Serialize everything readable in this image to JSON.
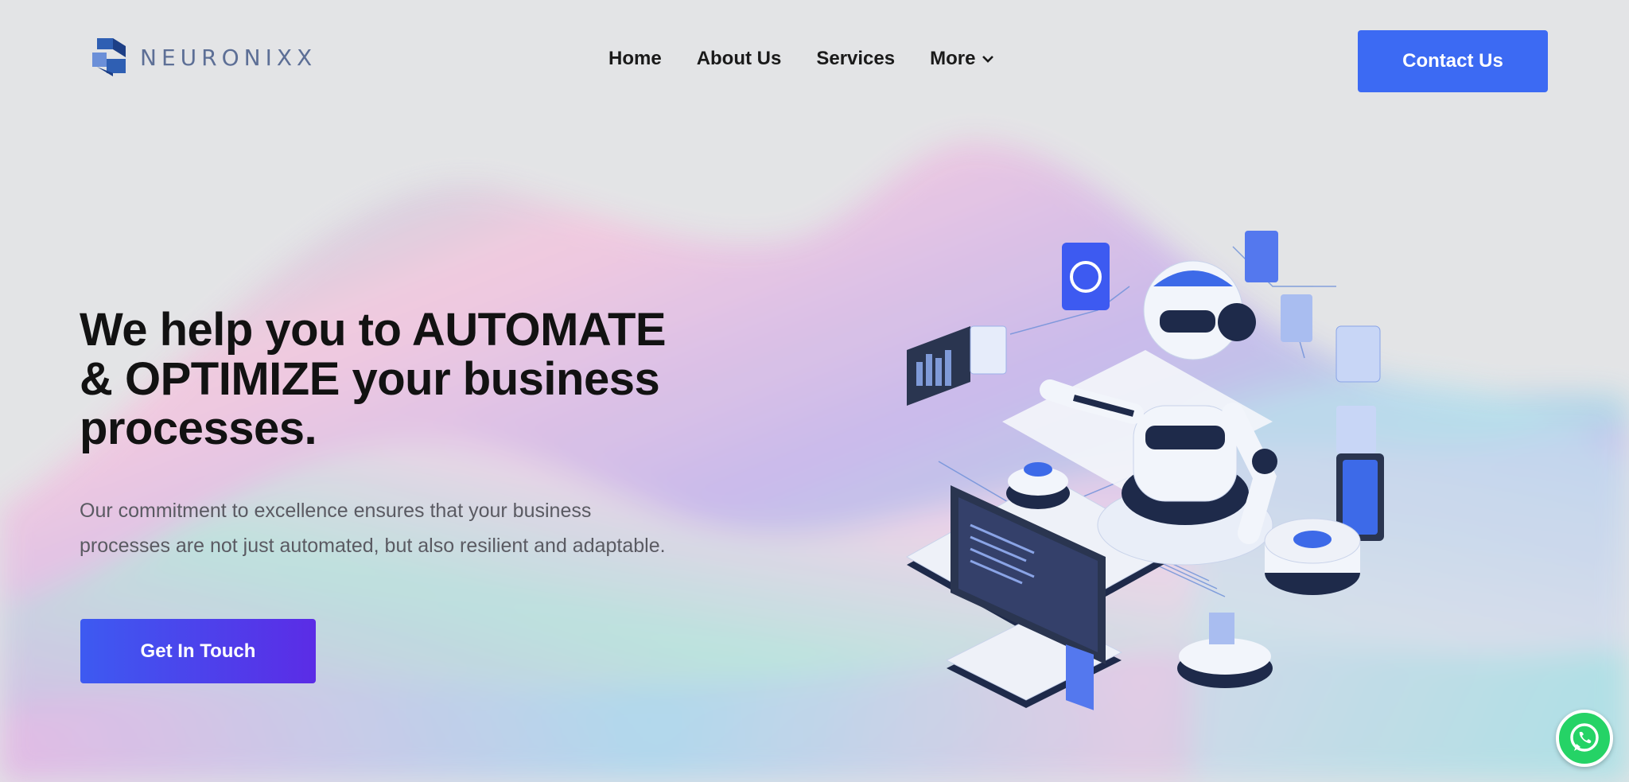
{
  "brand": {
    "name": "NEURONIXX",
    "logo_icon": "neuronixx-logo-icon",
    "logo_color": "#2f5fb3"
  },
  "nav": {
    "items": [
      "Home",
      "About Us",
      "Services"
    ],
    "more_label": "More"
  },
  "header": {
    "contact_label": "Contact Us"
  },
  "hero": {
    "headline": "We help you to AUTOMATE & OPTIMIZE your business processes.",
    "subtext": "Our commitment to excellence ensures that your business processes are not just automated, but also resilient and adaptable.",
    "cta_label": "Get In Touch"
  },
  "illustration": {
    "icon": "robot-automation-illustration"
  },
  "floating": {
    "icon": "whatsapp-icon"
  },
  "colors": {
    "accent": "#3c6af3",
    "cta_start": "#3d5af1",
    "cta_end": "#5b2ce6",
    "page_bg": "#e3e4e6",
    "whatsapp": "#25d366"
  }
}
